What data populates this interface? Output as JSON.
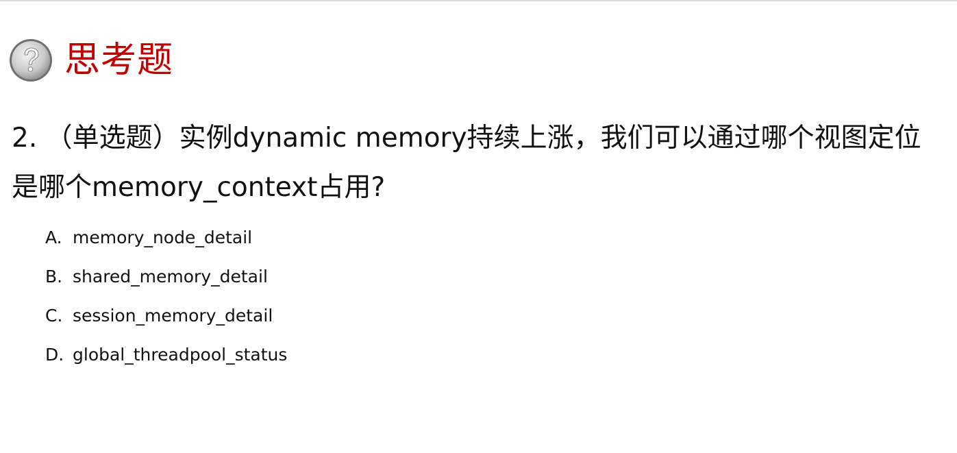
{
  "title": "思考题",
  "question": {
    "text": "2. （单选题）实例dynamic memory持续上涨，我们可以通过哪个视图定位是哪个memory_context占用?"
  },
  "options": [
    {
      "letter": "A.",
      "text": "memory_node_detail"
    },
    {
      "letter": "B.",
      "text": "shared_memory_detail"
    },
    {
      "letter": "C.",
      "text": "session_memory_detail"
    },
    {
      "letter": "D.",
      "text": "global_threadpool_status"
    }
  ],
  "colors": {
    "title": "#c00000",
    "text": "#111111"
  },
  "icons": {
    "header": "question-mark-icon"
  }
}
